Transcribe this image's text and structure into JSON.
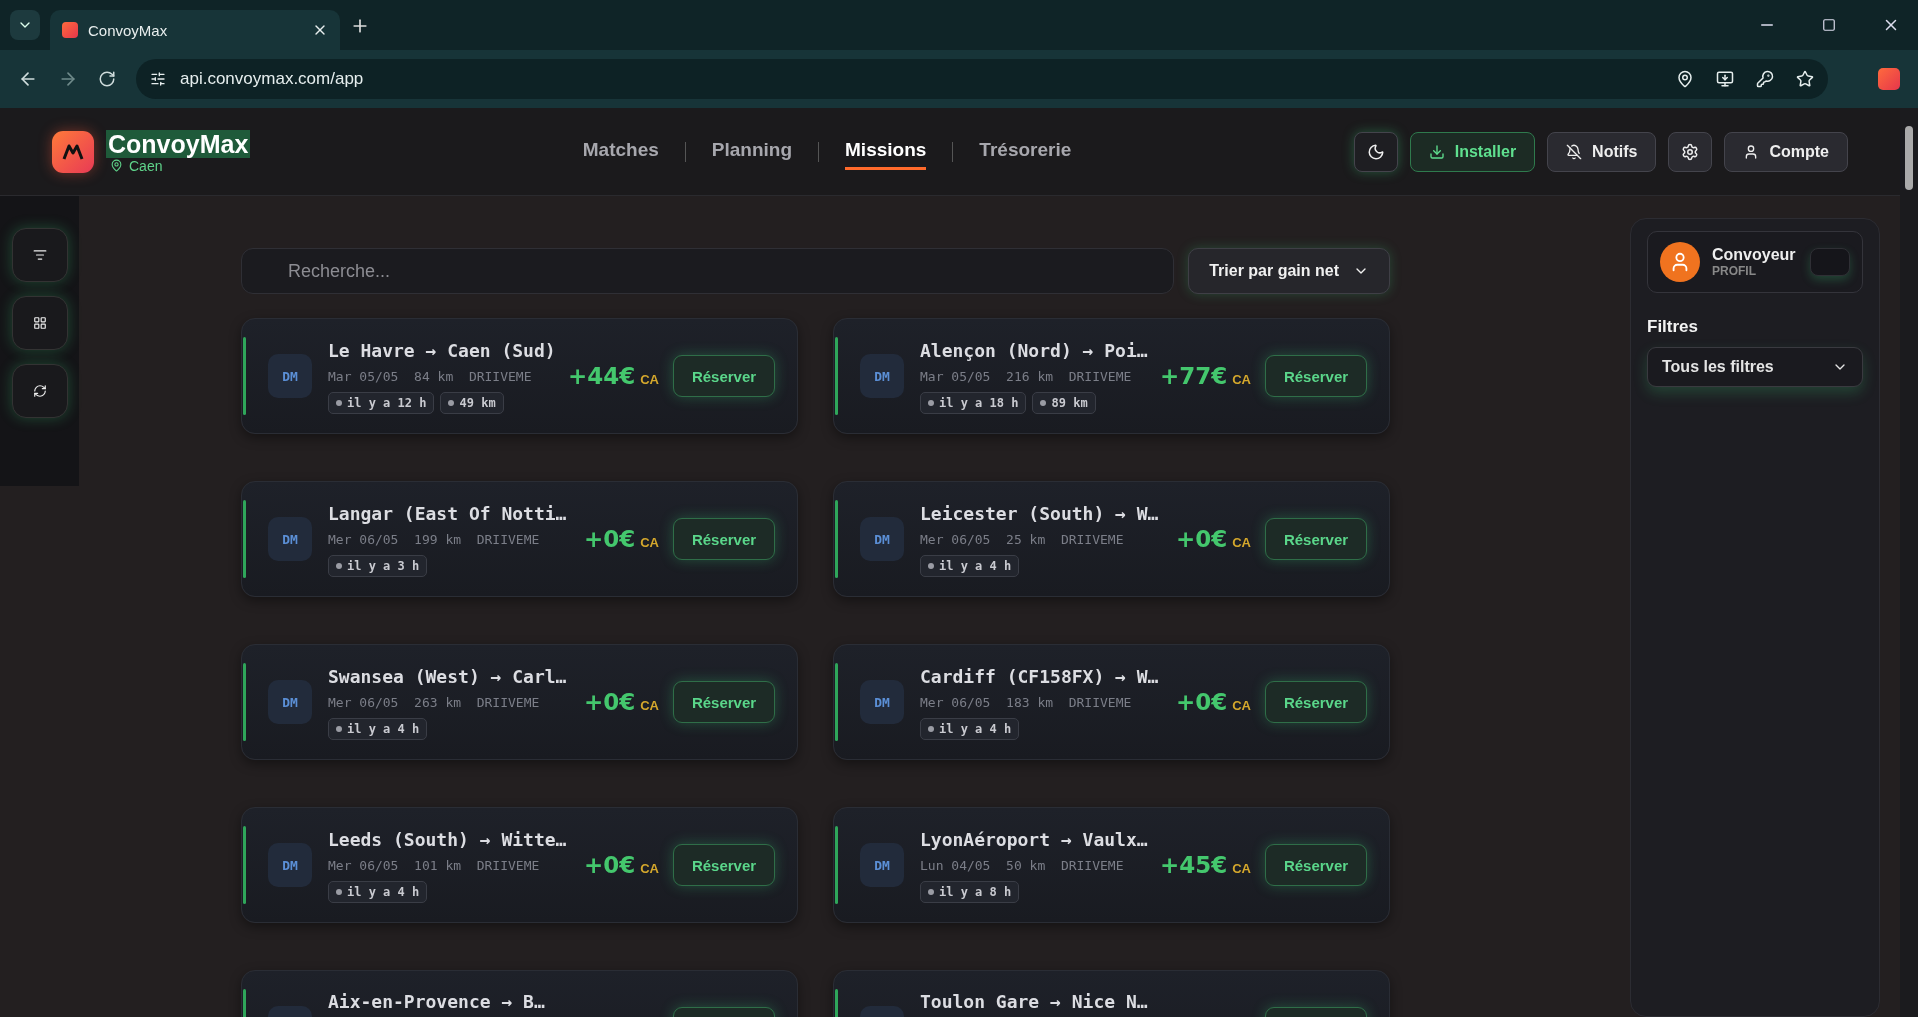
{
  "browser": {
    "tab_title": "ConvoyMax",
    "url": "api.convoymax.com/app"
  },
  "header": {
    "brand": "ConvoyMax",
    "city": "Caen",
    "nav": [
      {
        "label": "Matches",
        "selected": false
      },
      {
        "label": "Planning",
        "selected": false
      },
      {
        "label": "Missions",
        "selected": true
      },
      {
        "label": "Trésorerie",
        "selected": false
      }
    ],
    "actions": [
      {
        "kind": "theme"
      },
      {
        "kind": "install",
        "label": "Installer"
      },
      {
        "kind": "notifs",
        "label": "Notifs"
      },
      {
        "kind": "settings"
      },
      {
        "kind": "account",
        "label": "Compte"
      }
    ]
  },
  "rail": [
    {
      "kind": "filter"
    },
    {
      "kind": "grid"
    },
    {
      "kind": "refresh"
    }
  ],
  "search": {
    "placeholder": "Recherche..."
  },
  "sort": {
    "label": "Trier par gain net"
  },
  "missions": [
    {
      "badge": "DM",
      "title": "Le Havre → Caen (Sud)",
      "meta": "Mar 05/05  84 km  DRIIVEME",
      "tags": [
        "il y a 12 h",
        "49 km"
      ],
      "price": "+44€",
      "unit": "CA",
      "button": "Réserver"
    },
    {
      "badge": "DM",
      "title": "Alençon (Nord) → Poi…",
      "meta": "Mar 05/05  216 km  DRIIVEME",
      "tags": [
        "il y a 18 h",
        "89 km"
      ],
      "price": "+77€",
      "unit": "CA",
      "button": "Réserver"
    },
    {
      "badge": "DM",
      "title": "Langar (East Of Notti…",
      "meta": "Mer 06/05  199 km  DRIIVEME",
      "tags": [
        "il y a 3 h"
      ],
      "price": "+0€",
      "unit": "CA",
      "button": "Réserver"
    },
    {
      "badge": "DM",
      "title": "Leicester (South) → W…",
      "meta": "Mer 06/05  25 km  DRIIVEME",
      "tags": [
        "il y a 4 h"
      ],
      "price": "+0€",
      "unit": "CA",
      "button": "Réserver"
    },
    {
      "badge": "DM",
      "title": "Swansea (West) → Carl…",
      "meta": "Mer 06/05  263 km  DRIIVEME",
      "tags": [
        "il y a 4 h"
      ],
      "price": "+0€",
      "unit": "CA",
      "button": "Réserver"
    },
    {
      "badge": "DM",
      "title": "Cardiff (CF158FX) → W…",
      "meta": "Mer 06/05  183 km  DRIIVEME",
      "tags": [
        "il y a 4 h"
      ],
      "price": "+0€",
      "unit": "CA",
      "button": "Réserver"
    },
    {
      "badge": "DM",
      "title": "Leeds (South) → Witte…",
      "meta": "Mer 06/05  101 km  DRIIVEME",
      "tags": [
        "il y a 4 h"
      ],
      "price": "+0€",
      "unit": "CA",
      "button": "Réserver"
    },
    {
      "badge": "DM",
      "title": "LyonAéroport → Vaulx…",
      "meta": "Lun 04/05  50 km  DRIIVEME",
      "tags": [
        "il y a 8 h"
      ],
      "price": "+45€",
      "unit": "CA",
      "button": "Réserver"
    },
    {
      "title": "Aix-en-Provence → B…"
    },
    {
      "title": "Toulon Gare → Nice N…"
    }
  ],
  "panel": {
    "profile": {
      "name": "Convoyeur",
      "role": "PROFIL"
    },
    "filters_title": "Filtres",
    "filter_select": "Tous les filtres"
  }
}
